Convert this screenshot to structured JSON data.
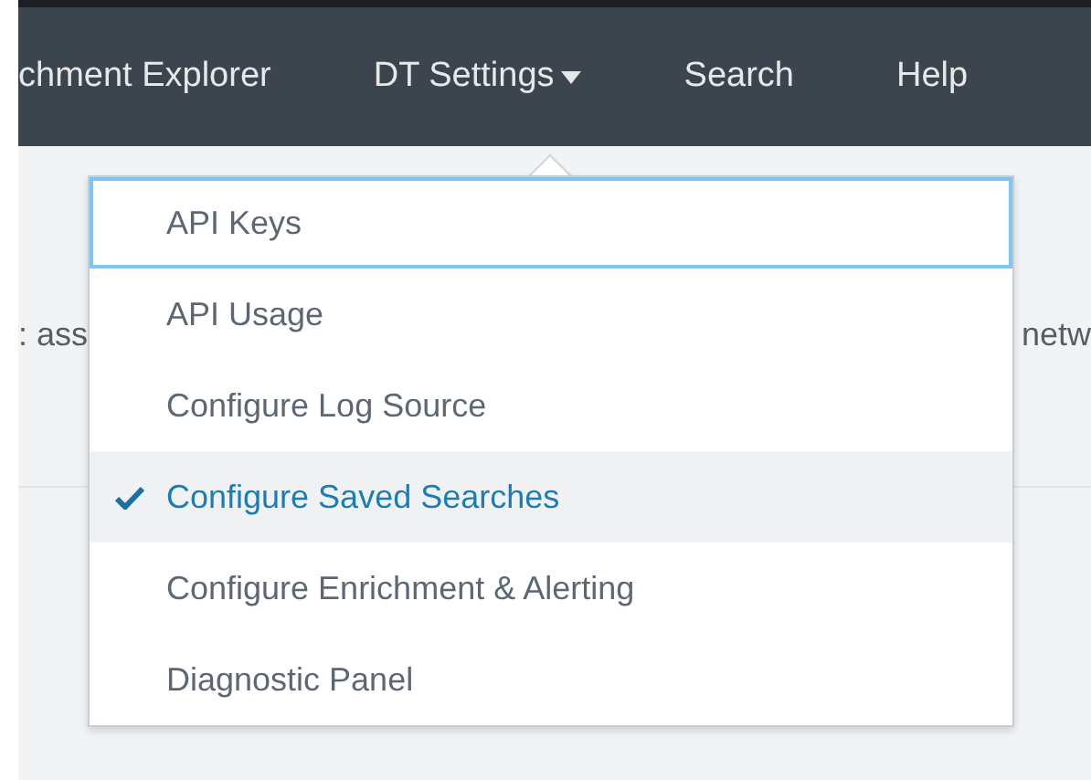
{
  "nav": {
    "items": [
      {
        "label": "chment Explorer",
        "kind": "link"
      },
      {
        "label": "DT Settings",
        "kind": "dropdown"
      },
      {
        "label": "Search",
        "kind": "link"
      },
      {
        "label": "Help",
        "kind": "link"
      }
    ]
  },
  "background": {
    "left_text": ": ass",
    "right_text": "netw"
  },
  "menu": {
    "items": [
      {
        "label": "API Keys",
        "checked": false,
        "focused": true
      },
      {
        "label": "API Usage",
        "checked": false,
        "focused": false
      },
      {
        "label": "Configure Log Source",
        "checked": false,
        "focused": false
      },
      {
        "label": "Configure Saved Searches",
        "checked": true,
        "focused": false
      },
      {
        "label": "Configure Enrichment & Alerting",
        "checked": false,
        "focused": false
      },
      {
        "label": "Diagnostic Panel",
        "checked": false,
        "focused": false
      }
    ]
  }
}
